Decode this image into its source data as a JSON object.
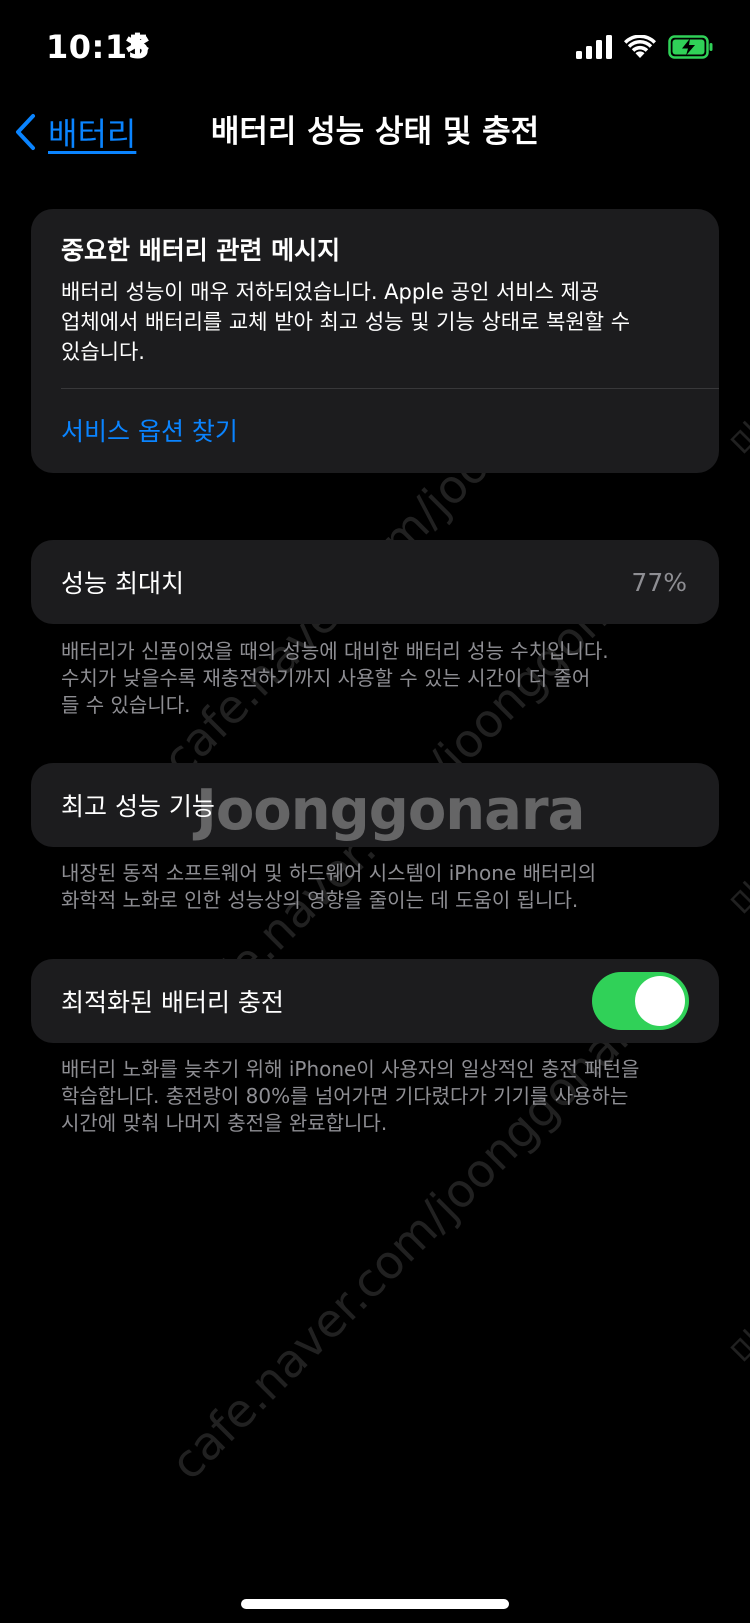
{
  "status_bar": {
    "time": "10:15",
    "time_extra": "✱"
  },
  "nav": {
    "back_label": "배터리",
    "title": "배터리 성능 상태 및 충전"
  },
  "message_card": {
    "title": "중요한 배터리 관련 메시지",
    "body_lines": [
      "배터리 성능이 매우 저하되었습니다. Apple 공인 서비스 제공",
      "업체에서 배터리를 교체 받아 최고 성능 및 기능 상태로 복원할 수",
      "있습니다."
    ],
    "link": "서비스 옵션 찾기"
  },
  "peak_capacity": {
    "label": "성능 최대치",
    "value": "77%",
    "footnote_lines": [
      "배터리가 신품이었을 때의 성능에 대비한 배터리 성능 수치입니다.",
      "수치가 낮을수록 재충전하기까지 사용할 수 있는 시간이 더 줄어",
      "들 수 있습니다."
    ]
  },
  "peak_performance": {
    "label": "최고 성능 기능",
    "footnote_lines": [
      "내장된 동적 소프트웨어 및 하드웨어 시스템이 iPhone 배터리의",
      "화학적 노화로 인한 성능상의 영향을 줄이는 데 도움이 됩니다."
    ]
  },
  "optimized_charging": {
    "label": "최적화된 배터리 충전",
    "enabled": true,
    "footnote_lines": [
      "배터리 노화를 늦추기 위해 iPhone이 사용자의 일상적인 충전 패턴을",
      "학습합니다. 충전량이 80%를 넘어가면 기다렸다가 기기를 사용하는",
      "시간에 맞춰 나머지 충전을 완료합니다."
    ]
  },
  "watermark": {
    "diagonal_1": "cafe.naver.com/joonggonara",
    "diagonal_2": "cafe.naver.com/joonggonara",
    "diagonal_3": "cafe.naver.com/joonggonara",
    "logo": "Joonggonara",
    "edge_mark": "미"
  },
  "colors": {
    "background": "#000000",
    "card": "#1c1c1e",
    "accent": "#0a84ff",
    "secondary_text": "#8e8e93",
    "toggle_on": "#30d158",
    "battery_charging": "#30d158"
  },
  "icons": {
    "back": "chevron-left-icon",
    "signal": "cellular-signal-icon",
    "wifi": "wifi-icon",
    "battery": "battery-charging-icon"
  }
}
